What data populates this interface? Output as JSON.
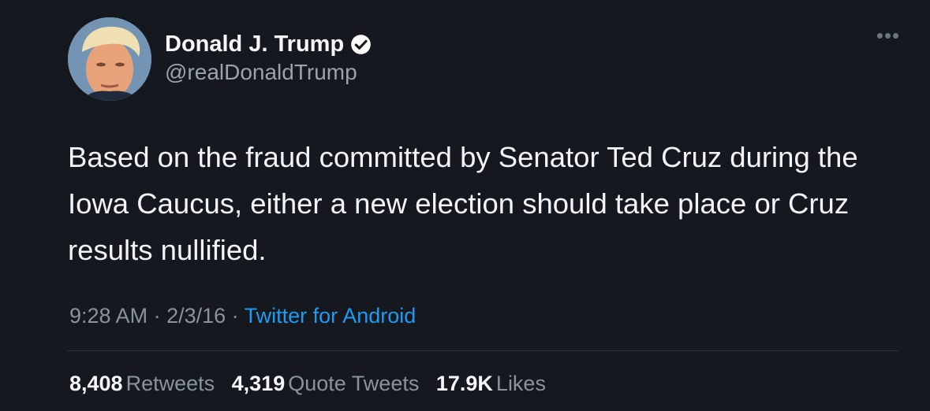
{
  "tweet": {
    "author": {
      "name": "Donald J. Trump",
      "handle": "@realDonaldTrump",
      "verified_icon": "verified-badge-icon"
    },
    "more_icon": "more-options-icon",
    "text": "Based on the fraud committed by Senator Ted Cruz during the Iowa Caucus, either a new election should take place or Cruz results nullified.",
    "time": "9:28 AM",
    "separator": " · ",
    "date": "2/3/16",
    "source": "Twitter for Android",
    "stats": {
      "retweets_count": "8,408",
      "retweets_label": "Retweets",
      "quotes_count": "4,319",
      "quotes_label": "Quote Tweets",
      "likes_count": "17.9K",
      "likes_label": "Likes"
    }
  },
  "colors": {
    "background": "#15181f",
    "link": "#1d9bf0",
    "secondary_text": "#8a939c"
  }
}
